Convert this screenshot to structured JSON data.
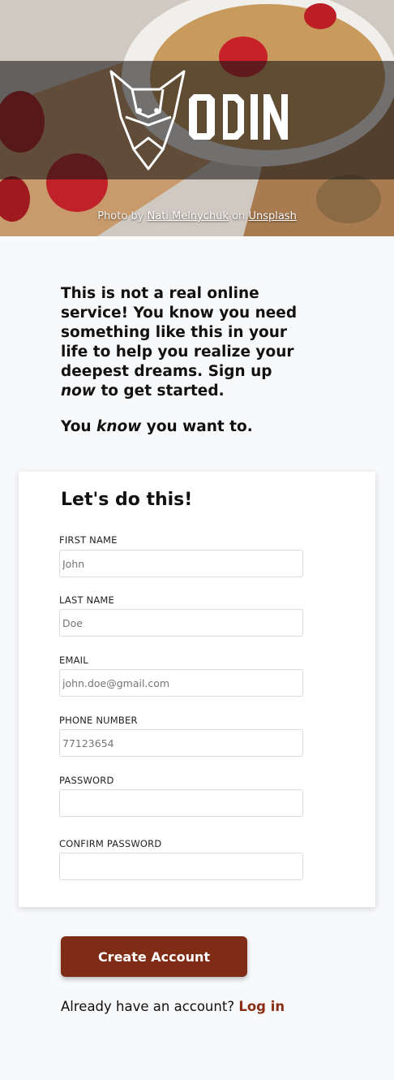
{
  "hero": {
    "brand_name": "ODIN",
    "credit_prefix": "Photo by",
    "credit_author": "Nati Melnychuk",
    "credit_mid": "on",
    "credit_site": "Unsplash"
  },
  "intro": {
    "line_part1": "This is not a real online service! You know you need something like this in your life to help you realize your deepest dreams. Sign up",
    "line_emphasis": "now",
    "line_part2": "to get started.",
    "line2_part1": "You",
    "line2_emphasis": "know",
    "line2_part2": "you want to."
  },
  "form": {
    "title": "Let's do this!",
    "fields": [
      {
        "label": "FIRST NAME",
        "value": ""
      },
      {
        "label": "LAST NAME",
        "value": ""
      },
      {
        "label": "EMAIL",
        "value": ""
      },
      {
        "label": "PHONE NUMBER",
        "value": ""
      },
      {
        "label": "PASSWORD",
        "value": ""
      },
      {
        "label": "CONFIRM PASSWORD",
        "value": ""
      }
    ],
    "placeholders": [
      "John",
      "Doe",
      "john.doe@gmail.com",
      "77123654",
      "",
      ""
    ]
  },
  "actions": {
    "create_label": "Create Account",
    "login_prompt": "Already have an account?",
    "login_link": "Log in"
  },
  "colors": {
    "accent": "#7f2c17",
    "link": "#8b2e16",
    "page_bg": "#f8f9fb"
  }
}
